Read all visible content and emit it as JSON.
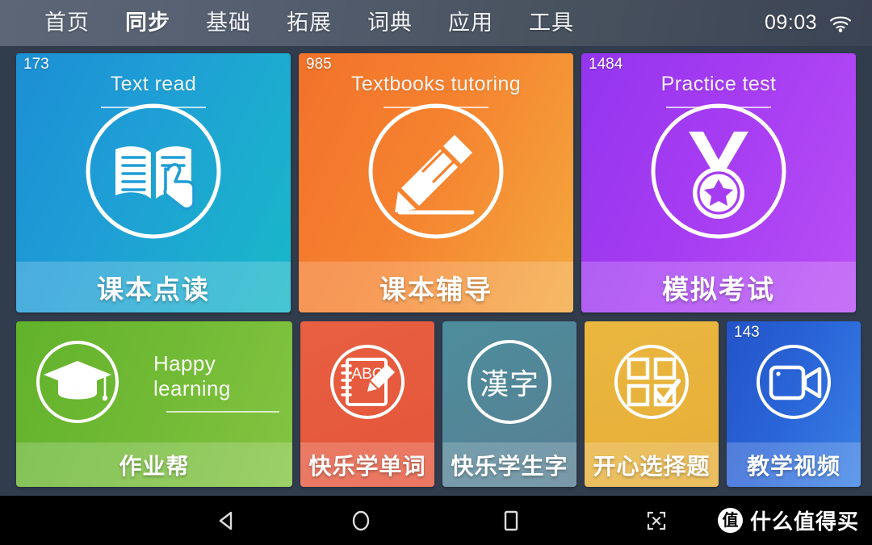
{
  "topbar": {
    "nav_items": [
      {
        "label": "首页",
        "active": false
      },
      {
        "label": "同步",
        "active": true
      },
      {
        "label": "基础",
        "active": false
      },
      {
        "label": "拓展",
        "active": false
      },
      {
        "label": "词典",
        "active": false
      },
      {
        "label": "应用",
        "active": false
      },
      {
        "label": "工具",
        "active": false
      }
    ],
    "clock": "09:03",
    "wifi_icon": "wifi-icon",
    "background_color": "#4c5666"
  },
  "tiles": {
    "text_read": {
      "badge": "173",
      "english": "Text read",
      "chinese": "课本点读",
      "icon": "book-touch-icon",
      "color": "#1f9ed6"
    },
    "textbook_tutoring": {
      "badge": "985",
      "english": "Textbooks tutoring",
      "chinese": "课本辅导",
      "icon": "pencil-icon",
      "color": "#f5822f"
    },
    "practice_test": {
      "badge": "1484",
      "english": "Practice test",
      "chinese": "模拟考试",
      "icon": "medal-icon",
      "color": "#a63cf2"
    },
    "homework_help": {
      "english": "Happy learning",
      "chinese": "作业帮",
      "icon": "graduation-cap-icon",
      "color": "#73bb36"
    },
    "happy_words": {
      "chinese": "快乐学单词",
      "icon": "abc-notebook-icon",
      "color": "#e4553a"
    },
    "happy_characters": {
      "chinese": "快乐学生字",
      "icon": "hanzi-icon",
      "icon_text": "漢字",
      "color": "#54869a"
    },
    "multiple_choice": {
      "chinese": "开心选择题",
      "icon": "checkbox-grid-icon",
      "color": "#e6ae38"
    },
    "teaching_video": {
      "badge": "143",
      "chinese": "教学视频",
      "icon": "video-camera-icon",
      "color": "#2a66d8"
    }
  },
  "navbar": {
    "back_icon": "back-triangle-icon",
    "home_icon": "home-circle-icon",
    "recents_icon": "recents-square-icon",
    "screenshot_icon": "screenshot-icon",
    "watermark_logo": "值",
    "watermark_text": "什么值得买"
  }
}
